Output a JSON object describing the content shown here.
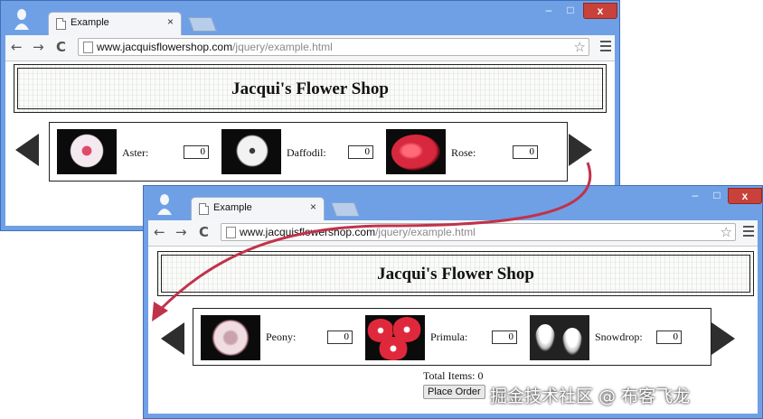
{
  "window1": {
    "tab_title": "Example",
    "tab_close": "×",
    "url_host": "www.jacquisflowershop.com",
    "url_path": "/jquery/example.html",
    "shop_title": "Jacqui's Flower Shop",
    "flowers": [
      {
        "name": "Aster:",
        "qty": "0"
      },
      {
        "name": "Daffodil:",
        "qty": "0"
      },
      {
        "name": "Rose:",
        "qty": "0"
      }
    ]
  },
  "window2": {
    "tab_title": "Example",
    "tab_close": "×",
    "url_host": "www.jacquisflowershop.com",
    "url_path": "/jquery/example.html",
    "shop_title": "Jacqui's Flower Shop",
    "flowers": [
      {
        "name": "Peony:",
        "qty": "0"
      },
      {
        "name": "Primula:",
        "qty": "0"
      },
      {
        "name": "Snowdrop:",
        "qty": "0"
      }
    ],
    "total_label": "Total Items: 0",
    "order_button": "Place Order"
  },
  "controls": {
    "minimize": "–",
    "maximize": "□",
    "close": "x"
  },
  "nav": {
    "back": "←",
    "forward": "→",
    "reload": "C",
    "star": "☆"
  },
  "watermark": "掘金技术社区 @ 布客飞龙",
  "colors": {
    "window_frame": "#6fa0e6",
    "close_button": "#c8413a",
    "connector_curve": "#c0334a"
  },
  "icons": [
    "user-avatar-icon",
    "page-icon",
    "back-arrow-icon",
    "forward-arrow-icon",
    "reload-icon",
    "star-icon",
    "menu-icon",
    "left-arrow-icon",
    "right-arrow-icon"
  ]
}
